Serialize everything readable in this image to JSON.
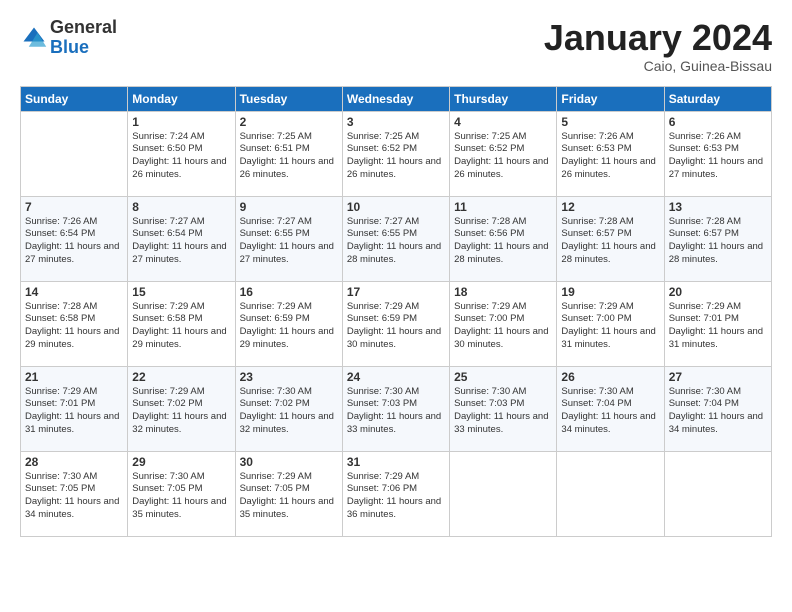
{
  "logo": {
    "general": "General",
    "blue": "Blue"
  },
  "title": "January 2024",
  "location": "Caio, Guinea-Bissau",
  "days_of_week": [
    "Sunday",
    "Monday",
    "Tuesday",
    "Wednesday",
    "Thursday",
    "Friday",
    "Saturday"
  ],
  "weeks": [
    [
      {
        "num": "",
        "text": ""
      },
      {
        "num": "1",
        "text": "Sunrise: 7:24 AM\nSunset: 6:50 PM\nDaylight: 11 hours and 26 minutes."
      },
      {
        "num": "2",
        "text": "Sunrise: 7:25 AM\nSunset: 6:51 PM\nDaylight: 11 hours and 26 minutes."
      },
      {
        "num": "3",
        "text": "Sunrise: 7:25 AM\nSunset: 6:52 PM\nDaylight: 11 hours and 26 minutes."
      },
      {
        "num": "4",
        "text": "Sunrise: 7:25 AM\nSunset: 6:52 PM\nDaylight: 11 hours and 26 minutes."
      },
      {
        "num": "5",
        "text": "Sunrise: 7:26 AM\nSunset: 6:53 PM\nDaylight: 11 hours and 26 minutes."
      },
      {
        "num": "6",
        "text": "Sunrise: 7:26 AM\nSunset: 6:53 PM\nDaylight: 11 hours and 27 minutes."
      }
    ],
    [
      {
        "num": "7",
        "text": "Sunrise: 7:26 AM\nSunset: 6:54 PM\nDaylight: 11 hours and 27 minutes."
      },
      {
        "num": "8",
        "text": "Sunrise: 7:27 AM\nSunset: 6:54 PM\nDaylight: 11 hours and 27 minutes."
      },
      {
        "num": "9",
        "text": "Sunrise: 7:27 AM\nSunset: 6:55 PM\nDaylight: 11 hours and 27 minutes."
      },
      {
        "num": "10",
        "text": "Sunrise: 7:27 AM\nSunset: 6:55 PM\nDaylight: 11 hours and 28 minutes."
      },
      {
        "num": "11",
        "text": "Sunrise: 7:28 AM\nSunset: 6:56 PM\nDaylight: 11 hours and 28 minutes."
      },
      {
        "num": "12",
        "text": "Sunrise: 7:28 AM\nSunset: 6:57 PM\nDaylight: 11 hours and 28 minutes."
      },
      {
        "num": "13",
        "text": "Sunrise: 7:28 AM\nSunset: 6:57 PM\nDaylight: 11 hours and 28 minutes."
      }
    ],
    [
      {
        "num": "14",
        "text": "Sunrise: 7:28 AM\nSunset: 6:58 PM\nDaylight: 11 hours and 29 minutes."
      },
      {
        "num": "15",
        "text": "Sunrise: 7:29 AM\nSunset: 6:58 PM\nDaylight: 11 hours and 29 minutes."
      },
      {
        "num": "16",
        "text": "Sunrise: 7:29 AM\nSunset: 6:59 PM\nDaylight: 11 hours and 29 minutes."
      },
      {
        "num": "17",
        "text": "Sunrise: 7:29 AM\nSunset: 6:59 PM\nDaylight: 11 hours and 30 minutes."
      },
      {
        "num": "18",
        "text": "Sunrise: 7:29 AM\nSunset: 7:00 PM\nDaylight: 11 hours and 30 minutes."
      },
      {
        "num": "19",
        "text": "Sunrise: 7:29 AM\nSunset: 7:00 PM\nDaylight: 11 hours and 31 minutes."
      },
      {
        "num": "20",
        "text": "Sunrise: 7:29 AM\nSunset: 7:01 PM\nDaylight: 11 hours and 31 minutes."
      }
    ],
    [
      {
        "num": "21",
        "text": "Sunrise: 7:29 AM\nSunset: 7:01 PM\nDaylight: 11 hours and 31 minutes."
      },
      {
        "num": "22",
        "text": "Sunrise: 7:29 AM\nSunset: 7:02 PM\nDaylight: 11 hours and 32 minutes."
      },
      {
        "num": "23",
        "text": "Sunrise: 7:30 AM\nSunset: 7:02 PM\nDaylight: 11 hours and 32 minutes."
      },
      {
        "num": "24",
        "text": "Sunrise: 7:30 AM\nSunset: 7:03 PM\nDaylight: 11 hours and 33 minutes."
      },
      {
        "num": "25",
        "text": "Sunrise: 7:30 AM\nSunset: 7:03 PM\nDaylight: 11 hours and 33 minutes."
      },
      {
        "num": "26",
        "text": "Sunrise: 7:30 AM\nSunset: 7:04 PM\nDaylight: 11 hours and 34 minutes."
      },
      {
        "num": "27",
        "text": "Sunrise: 7:30 AM\nSunset: 7:04 PM\nDaylight: 11 hours and 34 minutes."
      }
    ],
    [
      {
        "num": "28",
        "text": "Sunrise: 7:30 AM\nSunset: 7:05 PM\nDaylight: 11 hours and 34 minutes."
      },
      {
        "num": "29",
        "text": "Sunrise: 7:30 AM\nSunset: 7:05 PM\nDaylight: 11 hours and 35 minutes."
      },
      {
        "num": "30",
        "text": "Sunrise: 7:29 AM\nSunset: 7:05 PM\nDaylight: 11 hours and 35 minutes."
      },
      {
        "num": "31",
        "text": "Sunrise: 7:29 AM\nSunset: 7:06 PM\nDaylight: 11 hours and 36 minutes."
      },
      {
        "num": "",
        "text": ""
      },
      {
        "num": "",
        "text": ""
      },
      {
        "num": "",
        "text": ""
      }
    ]
  ]
}
